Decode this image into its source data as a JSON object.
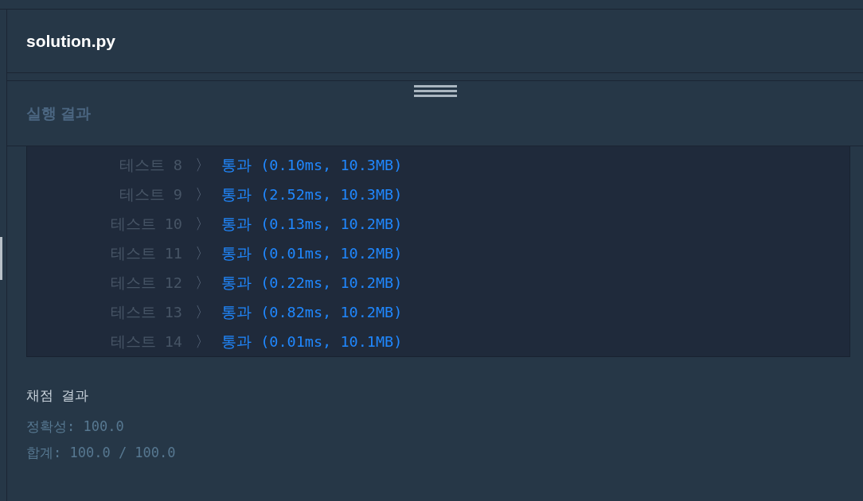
{
  "editor": {
    "file_name": "solution.py"
  },
  "results": {
    "title": "실행 결과",
    "tests": [
      {
        "label": "테스트 8",
        "separator": "〉",
        "result": "통과 (0.10ms, 10.3MB)"
      },
      {
        "label": "테스트 9",
        "separator": "〉",
        "result": "통과 (2.52ms, 10.3MB)"
      },
      {
        "label": "테스트 10",
        "separator": "〉",
        "result": "통과 (0.13ms, 10.2MB)"
      },
      {
        "label": "테스트 11",
        "separator": "〉",
        "result": "통과 (0.01ms, 10.2MB)"
      },
      {
        "label": "테스트 12",
        "separator": "〉",
        "result": "통과 (0.22ms, 10.2MB)"
      },
      {
        "label": "테스트 13",
        "separator": "〉",
        "result": "통과 (0.82ms, 10.2MB)"
      },
      {
        "label": "테스트 14",
        "separator": "〉",
        "result": "통과 (0.01ms, 10.1MB)"
      }
    ]
  },
  "grading": {
    "title": "채점 결과",
    "lines": [
      "정확성: 100.0",
      "합계: 100.0 / 100.0"
    ]
  }
}
